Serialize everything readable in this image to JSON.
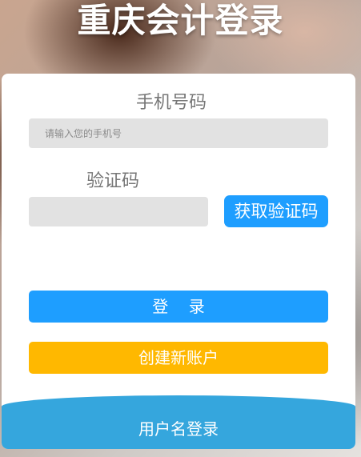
{
  "title": "重庆会计登录",
  "form": {
    "phone_label": "手机号码",
    "phone_placeholder": "请输入您的手机号",
    "phone_value": "",
    "code_label": "验证码",
    "code_placeholder": "",
    "code_value": "",
    "get_code_label": "获取验证码",
    "login_label": "登    录",
    "create_account_label": "创建新账户"
  },
  "footer": {
    "username_login_label": "用户名登录"
  },
  "colors": {
    "primary_blue": "#1e9eff",
    "create_orange": "#ffb800",
    "footer_blue": "#35a6dd",
    "input_gray": "#e2e2e2",
    "label_gray": "#777777"
  }
}
